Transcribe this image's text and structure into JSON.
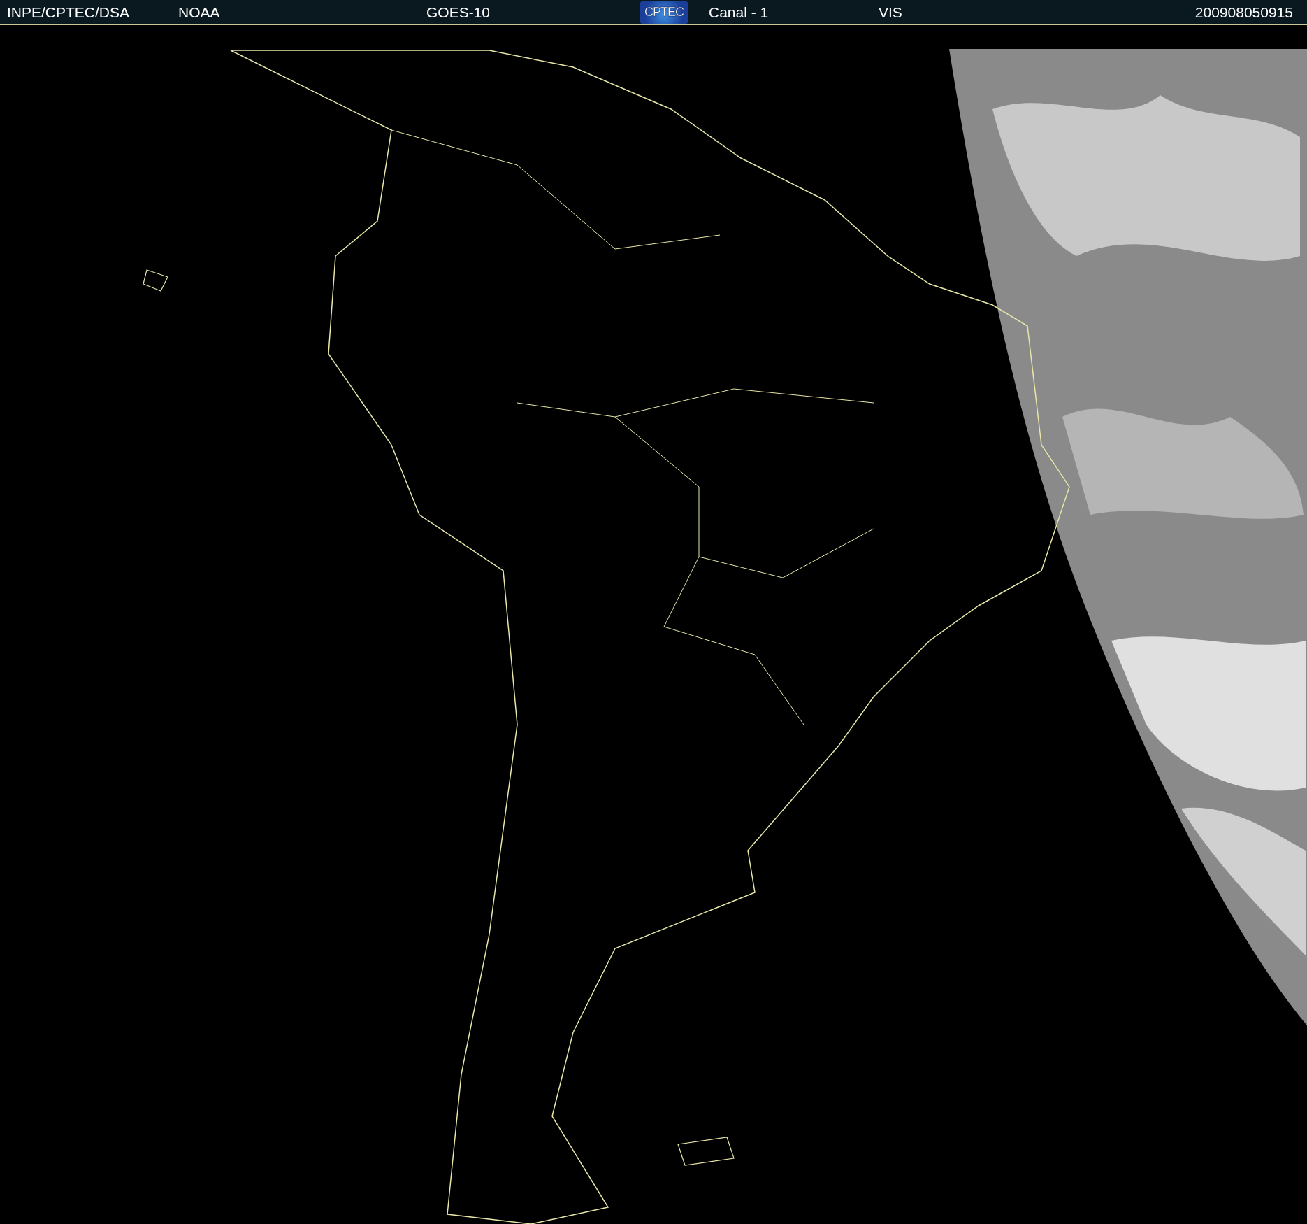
{
  "header": {
    "fields": [
      {
        "text": "INPE/CPTEC/DSA",
        "kind": "text"
      },
      {
        "text": "NOAA",
        "kind": "text"
      },
      {
        "text": "GOES-10",
        "kind": "text"
      },
      {
        "text": "CPTEC",
        "kind": "logo"
      },
      {
        "text": "Canal - 1",
        "kind": "text"
      },
      {
        "text": "VIS",
        "kind": "text"
      },
      {
        "text": "200908050915",
        "kind": "text"
      }
    ]
  }
}
